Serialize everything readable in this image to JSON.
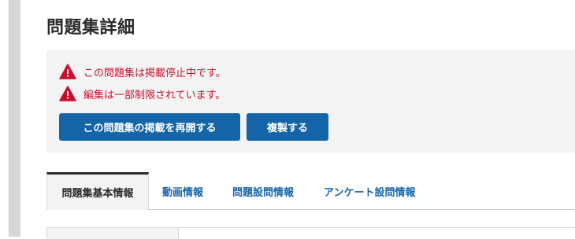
{
  "page": {
    "title": "問題集詳細"
  },
  "notices": {
    "items": [
      {
        "icon": "warning-icon",
        "text": "この問題集は掲載停止中です。"
      },
      {
        "icon": "warning-icon",
        "text": "編集は一部制限されています。"
      }
    ],
    "color": "#c8102e"
  },
  "actions": {
    "resume_label": "この問題集の掲載を再開する",
    "duplicate_label": "複製する",
    "color": "#1464a8"
  },
  "tabs": {
    "items": [
      {
        "label": "問題集基本情報",
        "active": true
      },
      {
        "label": "動画情報",
        "active": false
      },
      {
        "label": "問題設問情報",
        "active": false
      },
      {
        "label": "アンケート設問情報",
        "active": false
      }
    ]
  }
}
